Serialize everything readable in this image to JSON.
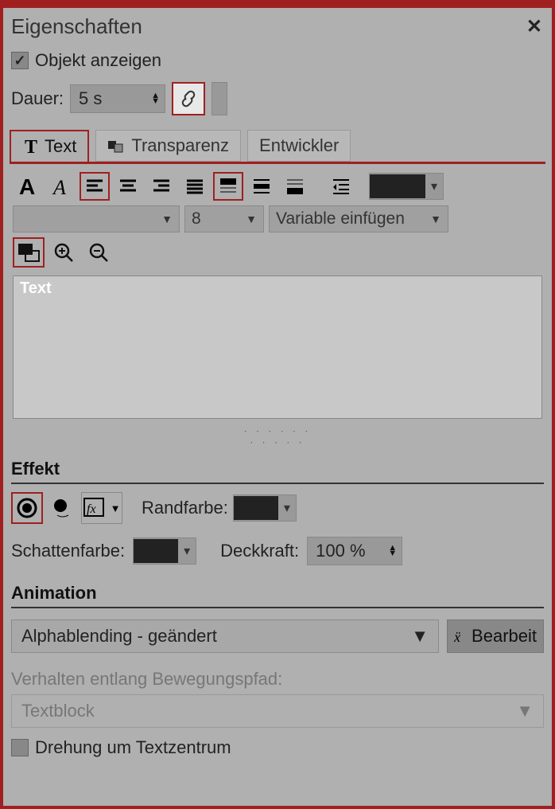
{
  "panel": {
    "title": "Eigenschaften",
    "show_object_label": "Objekt anzeigen",
    "show_object_checked": true,
    "duration_label": "Dauer:",
    "duration_value": "5 s"
  },
  "tabs": {
    "text": "Text",
    "transparency": "Transparenz",
    "developer": "Entwickler",
    "active": "text"
  },
  "text_toolbar": {
    "font_size": "8",
    "insert_variable": "Variable einfügen",
    "textarea_placeholder": "Text"
  },
  "effect": {
    "title": "Effekt",
    "border_color_label": "Randfarbe:",
    "border_color": "#000000",
    "shadow_color_label": "Schattenfarbe:",
    "shadow_color": "#000000",
    "opacity_label": "Deckkraft:",
    "opacity_value": "100 %"
  },
  "animation": {
    "title": "Animation",
    "type": "Alphablending - geändert",
    "edit_label": "Bearbeit",
    "motion_path_label": "Verhalten entlang Bewegungspfad:",
    "motion_path_value": "Textblock",
    "rotate_center_label": "Drehung um Textzentrum",
    "rotate_center_checked": false
  }
}
